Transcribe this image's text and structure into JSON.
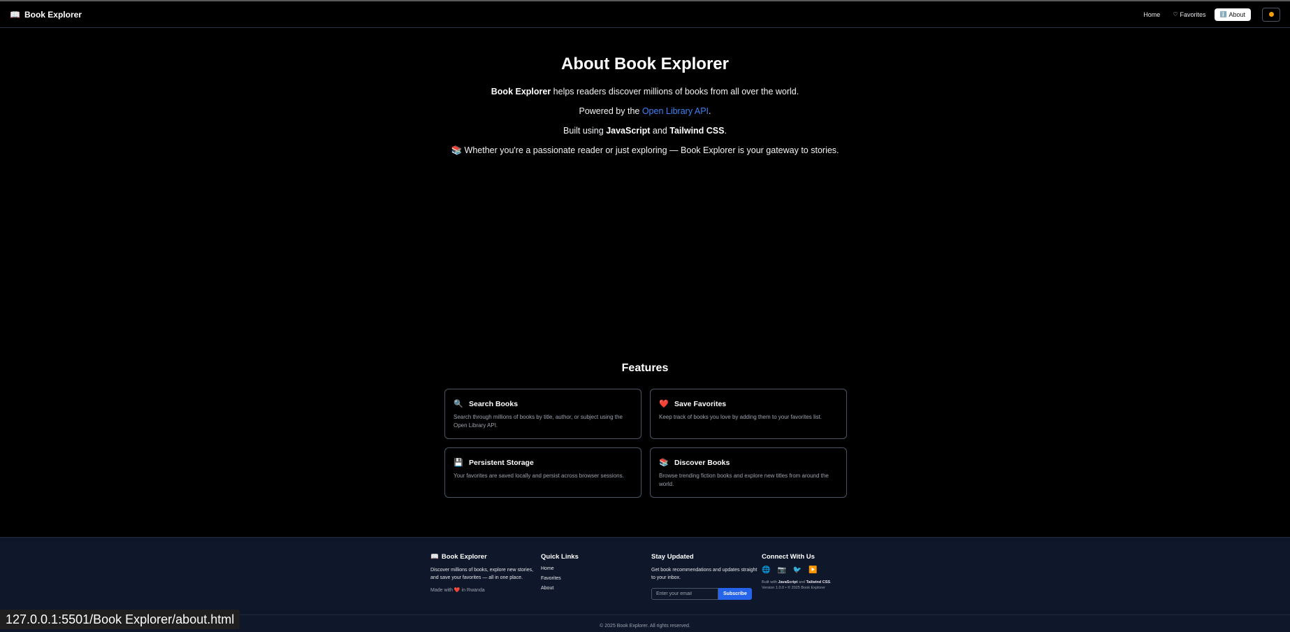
{
  "nav": {
    "brand": "Book Explorer",
    "brand_icon": "📖",
    "home": "Home",
    "favorites": "Favorites",
    "favorites_icon": "♡",
    "about": "About",
    "about_icon": "ℹ️"
  },
  "about": {
    "title": "About Book Explorer",
    "line1_bold": "Book Explorer",
    "line1_rest": " helps readers discover millions of books from all over the world.",
    "line2_pre": "Powered by the ",
    "line2_link": "Open Library API",
    "line2_post": ".",
    "line3_pre": "Built using ",
    "line3_b1": "JavaScript",
    "line3_mid": " and ",
    "line3_b2": "Tailwind CSS",
    "line3_post": ".",
    "line4_icon": "📚",
    "line4": " Whether you're a passionate reader or just exploring — Book Explorer is your gateway to stories."
  },
  "features": {
    "title": "Features",
    "items": [
      {
        "icon": "🔍",
        "title": "Search Books",
        "desc": "Search through millions of books by title, author, or subject using the Open Library API."
      },
      {
        "icon": "❤️",
        "title": "Save Favorites",
        "desc": "Keep track of books you love by adding them to your favorites list."
      },
      {
        "icon": "💾",
        "title": "Persistent Storage",
        "desc": "Your favorites are saved locally and persist across browser sessions."
      },
      {
        "icon": "📚",
        "title": "Discover Books",
        "desc": "Browse trending fiction books and explore new titles from around the world."
      }
    ]
  },
  "footer": {
    "brand": "Book Explorer",
    "brand_icon": "📖",
    "brand_desc": "Discover millions of books, explore new stories, and save your favorites — all in one place.",
    "made_pre": "Made with ",
    "made_heart": "❤️",
    "made_post": " in Rwanda",
    "quick_title": "Quick Links",
    "quick_links": [
      "Home",
      "Favorites",
      "About"
    ],
    "stay_title": "Stay Updated",
    "stay_desc": "Get book recommendations and updates straight to your inbox.",
    "email_placeholder": "Enter your email",
    "subscribe": "Subscribe",
    "connect_title": "Connect With Us",
    "socials": [
      "🌐",
      "📷",
      "🐦",
      "▶️"
    ],
    "built_pre": "Built with ",
    "built_b1": "JavaScript",
    "built_mid": " and ",
    "built_b2": "Tailwind CSS",
    "built_post": ".",
    "version": "Version 1.0.0 • © 2025 Book Explorer",
    "copyright": "© 2025 Book Explorer. All rights reserved."
  },
  "status_bar": {
    "url": "127.0.0.1:5501/Book Explorer/about.html"
  },
  "colors": {
    "background": "#000000",
    "link": "#3b82f6",
    "footer_bg": "#0f172a",
    "subscribe_btn": "#2563eb"
  }
}
